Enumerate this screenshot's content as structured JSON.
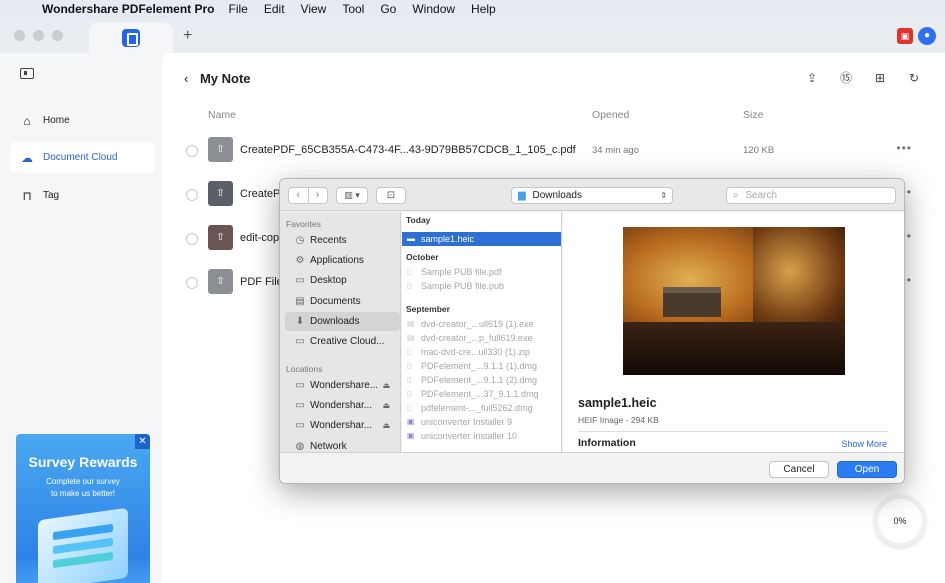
{
  "menubar": {
    "app_name": "Wondershare PDFelement Pro",
    "items": [
      "File",
      "Edit",
      "View",
      "Tool",
      "Go",
      "Window",
      "Help"
    ]
  },
  "sidebar": {
    "items": [
      {
        "label": "Home",
        "icon": "home-icon"
      },
      {
        "label": "Document Cloud",
        "icon": "cloud-icon",
        "active": true
      },
      {
        "label": "Tag",
        "icon": "tag-icon"
      }
    ]
  },
  "main": {
    "title": "My Note",
    "columns": {
      "name": "Name",
      "opened": "Opened",
      "size": "Size"
    },
    "rows": [
      {
        "name": "CreatePDF_65CB355A-C473-4F...43-9D79BB57CDCB_1_105_c.pdf",
        "opened": "34 min ago",
        "size": "120 KB"
      },
      {
        "name": "CreateP",
        "opened": "",
        "size": ""
      },
      {
        "name": "edit-cop",
        "opened": "",
        "size": ""
      },
      {
        "name": "PDF File",
        "opened": "",
        "size": ""
      }
    ]
  },
  "survey": {
    "title": "Survey Rewards",
    "subtitle_line1": "Complete our survey",
    "subtitle_line2": "to make us better!"
  },
  "progress": {
    "label": "0%",
    "value": 0
  },
  "dialog": {
    "location": "Downloads",
    "search_placeholder": "Search",
    "favorites_header": "Favorites",
    "favorites": [
      {
        "label": "Recents",
        "icon": "clock-icon"
      },
      {
        "label": "Applications",
        "icon": "apps-icon"
      },
      {
        "label": "Desktop",
        "icon": "desktop-icon"
      },
      {
        "label": "Documents",
        "icon": "document-icon"
      },
      {
        "label": "Downloads",
        "icon": "download-icon",
        "selected": true
      },
      {
        "label": "Creative Cloud...",
        "icon": "folder-icon"
      }
    ],
    "locations_header": "Locations",
    "locations": [
      {
        "label": "Wondershare...",
        "icon": "disk-icon"
      },
      {
        "label": "Wondershar...",
        "icon": "disk-icon"
      },
      {
        "label": "Wondershar...",
        "icon": "disk-icon"
      },
      {
        "label": "Network",
        "icon": "globe-icon"
      }
    ],
    "groups": [
      {
        "header": "Today",
        "files": [
          {
            "name": "sample1.heic",
            "selected": true
          }
        ]
      },
      {
        "header": "October",
        "files": [
          {
            "name": "Sample PUB file.pdf"
          },
          {
            "name": "Sample PUB file.pub"
          }
        ]
      },
      {
        "header": "September",
        "files": [
          {
            "name": "dvd-creator_...ull619 (1).exe"
          },
          {
            "name": "dvd-creator_...p_full619.exe"
          },
          {
            "name": "mac-dvd-cre...ull330 (1).zip"
          },
          {
            "name": "PDFelement_...9.1.1 (1).dmg"
          },
          {
            "name": "PDFelement_...9.1.1 (2).dmg"
          },
          {
            "name": "PDFelement_...37_9.1.1.dmg"
          },
          {
            "name": "pdfelement-..._full5262.dmg"
          },
          {
            "name": "uniconverter Installer 9"
          },
          {
            "name": "uniconverter Installer 10"
          }
        ]
      }
    ],
    "preview": {
      "name": "sample1.heic",
      "kind": "HEIF Image - 294 KB",
      "info_header": "Information",
      "show_more": "Show More"
    },
    "cancel_label": "Cancel",
    "open_label": "Open"
  },
  "colors": {
    "accent": "#2b7cf0",
    "selection": "#2e6fd4",
    "link": "#2b67d8"
  }
}
